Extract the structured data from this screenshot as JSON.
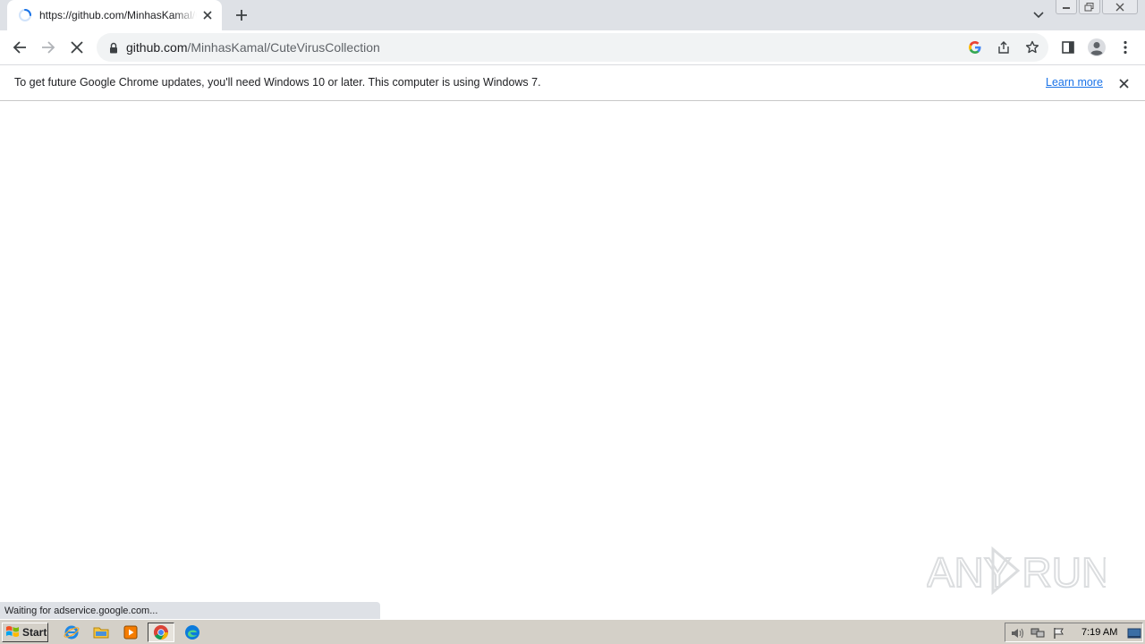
{
  "tab": {
    "title": "https://github.com/MinhasKamal/CuteVirusCollection",
    "loading": true
  },
  "toolbar": {
    "url_host": "github.com",
    "url_path": "/MinhasKamal/CuteVirusCollection"
  },
  "infobar": {
    "message": "To get future Google Chrome updates, you'll need Windows 10 or later. This computer is using Windows 7.",
    "link_label": "Learn more"
  },
  "status": {
    "text": "Waiting for adservice.google.com..."
  },
  "watermark": {
    "text": "ANY RUN"
  },
  "taskbar": {
    "start_label": "Start",
    "apps": [
      "internet-explorer-icon",
      "file-explorer-icon",
      "media-player-icon",
      "chrome-icon",
      "edge-icon"
    ],
    "clock": "7:19 AM"
  },
  "colors": {
    "tabstrip": "#dee1e6",
    "omnibox": "#f1f3f4",
    "link": "#1a73e8",
    "taskbar": "#d4d0c8"
  }
}
